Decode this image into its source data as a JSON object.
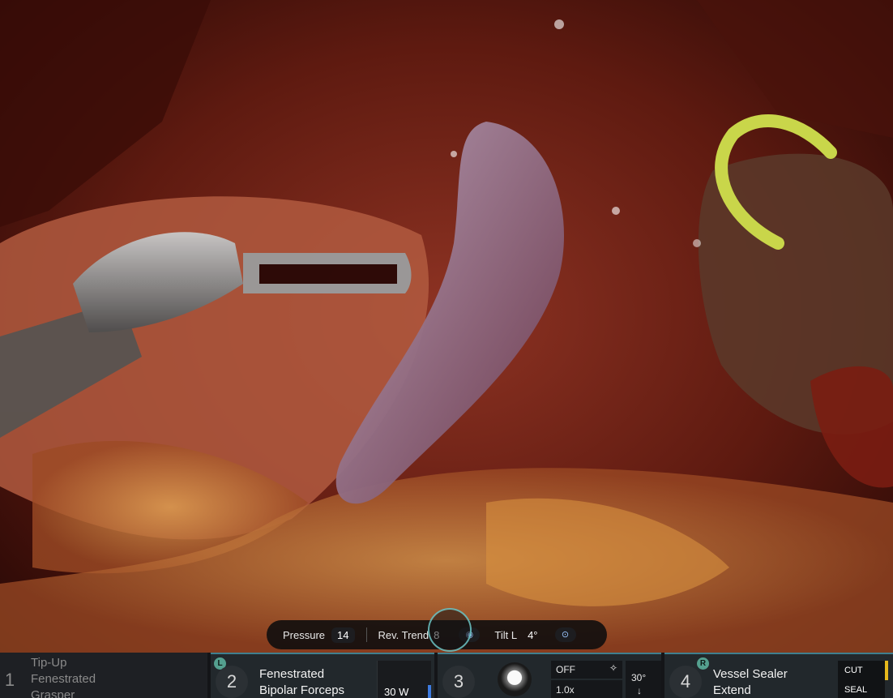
{
  "hud": {
    "pressure_label": "Pressure",
    "pressure_value": "14",
    "trend_label": "Rev. Trend",
    "trend_value": "8",
    "tilt_label": "Tilt L",
    "tilt_value": "4°"
  },
  "instruments": [
    {
      "slot": "1",
      "name_line1": "Tip-Up",
      "name_line2": "Fenestrated",
      "name_line3": "Grasper"
    },
    {
      "slot": "2",
      "side": "L",
      "name_line1": "Fenestrated",
      "name_line2": "Bipolar Forceps",
      "power": "30 W"
    },
    {
      "slot": "3",
      "mode": "OFF",
      "zoom": "1.0x",
      "angle": "30°",
      "angle_arrow": "↓"
    },
    {
      "slot": "4",
      "side": "R",
      "name_line1": "Vessel Sealer",
      "name_line2": "Extend",
      "cut_label": "CUT",
      "seal_label": "SEAL"
    }
  ],
  "colors": {
    "tissue_dark": "#3a0d08",
    "tissue_mid": "#8a2a1c",
    "fat_yellow": "#c98a3a",
    "needle_green": "#c9d64a",
    "accent_teal": "#54a08f",
    "power_blue": "#3d7be0",
    "seal_yellow": "#e6b91c"
  }
}
